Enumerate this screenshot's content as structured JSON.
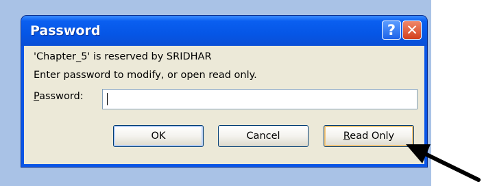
{
  "dialog": {
    "title": "Password",
    "help_glyph": "?",
    "close_glyph": "✕",
    "message_line1": "'Chapter_5' is reserved by SRIDHAR",
    "message_line2": "Enter password to modify, or open read only.",
    "password_label_access_key": "P",
    "password_label_rest": "assword:",
    "password_value": "",
    "buttons": {
      "ok": "OK",
      "cancel": "Cancel",
      "read_only_access_key": "R",
      "read_only_rest": "ead Only"
    }
  },
  "icons": {
    "help": "help-icon",
    "close": "close-icon",
    "annotation": "arrow-pointer-icon"
  },
  "colors": {
    "titlebar": "#0656e6",
    "close_button": "#d3401c",
    "dialog_face": "#ece9d8",
    "backdrop": "#a9c2e6"
  }
}
